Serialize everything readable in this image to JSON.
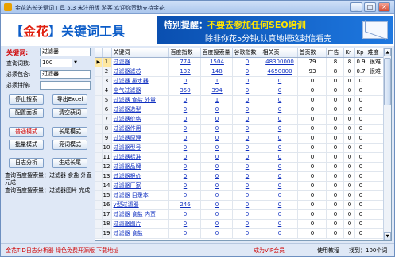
{
  "window": {
    "title": "金花站长关键词工具 5.3 未注册版 游客 欢迎你赞助支持金花",
    "controls": [
      "_",
      "□",
      "×"
    ]
  },
  "banner": {
    "brand_open": "【",
    "brand_hl": "金花",
    "brand_close": "】关键词工具",
    "promo_line1_a": "特别提醒：",
    "promo_line1_b": "不要去参加任何SEO培训",
    "promo_line2": "除非你花5分钟,认真地把这封信看完"
  },
  "form": {
    "keyword_label": "关键词:",
    "keyword_value": "过滤器",
    "limit_label": "查询词数:",
    "limit_value": "100",
    "must_include_label": "必须包含:",
    "must_include_value": "过滤器",
    "must_exclude_label": "必须排除:",
    "must_exclude_value": ""
  },
  "buttons": {
    "stop": "停止搜索",
    "export": "导出Excel",
    "config": "配置面板",
    "clear": "清空获词",
    "mode_normal": "普通模式",
    "mode_long": "长尾模式",
    "mode_batch": "批量模式",
    "mode_competitor": "竞词模式",
    "log": "日志分析",
    "gen_long": "生成长尾"
  },
  "status_lines": [
    "查询百度搜索量：过滤器 食盐 外直 元成",
    "查询百度搜索量：过滤器图片 完成"
  ],
  "table": {
    "columns": [
      "",
      "关键词",
      "百度指数",
      "百度搜索量",
      "谷歌指数",
      "相关页",
      "首页数",
      "广告",
      "Kr",
      "Kp",
      "难度"
    ],
    "rows": [
      [
        "1",
        "过滤器",
        "774",
        "1504",
        "0",
        "48300000",
        "79",
        "8",
        "8",
        "0.9",
        "很难"
      ],
      [
        "2",
        "过滤器滤芯",
        "132",
        "148",
        "0",
        "4650000",
        "93",
        "8",
        "0",
        "0.7",
        "很难"
      ],
      [
        "3",
        "过滤器 排水器",
        "0",
        "1",
        "0",
        "0",
        "0",
        "0",
        "0",
        "0",
        ""
      ],
      [
        "4",
        "空气过滤器",
        "350",
        "394",
        "0",
        "0",
        "0",
        "0",
        "0",
        "0",
        ""
      ],
      [
        "5",
        "过滤器 食盐 外量",
        "0",
        "1",
        "0",
        "0",
        "0",
        "0",
        "0",
        "0",
        ""
      ],
      [
        "6",
        "过滤器选型",
        "0",
        "0",
        "0",
        "0",
        "0",
        "0",
        "0",
        "0",
        ""
      ],
      [
        "7",
        "过滤器价格",
        "0",
        "0",
        "0",
        "0",
        "0",
        "0",
        "0",
        "0",
        ""
      ],
      [
        "8",
        "过滤器作用",
        "0",
        "0",
        "0",
        "0",
        "0",
        "0",
        "0",
        "0",
        ""
      ],
      [
        "9",
        "过滤器原理",
        "0",
        "0",
        "0",
        "0",
        "0",
        "0",
        "0",
        "0",
        ""
      ],
      [
        "10",
        "过滤器型号",
        "0",
        "0",
        "0",
        "0",
        "0",
        "0",
        "0",
        "0",
        ""
      ],
      [
        "11",
        "过滤器标准",
        "0",
        "0",
        "0",
        "0",
        "0",
        "0",
        "0",
        "0",
        ""
      ],
      [
        "12",
        "过滤器品牌",
        "0",
        "0",
        "0",
        "0",
        "0",
        "0",
        "0",
        "0",
        ""
      ],
      [
        "13",
        "过滤器报价",
        "0",
        "0",
        "0",
        "0",
        "0",
        "0",
        "0",
        "0",
        ""
      ],
      [
        "14",
        "过滤器厂家",
        "0",
        "0",
        "0",
        "0",
        "0",
        "0",
        "0",
        "0",
        ""
      ],
      [
        "15",
        "过滤器 目录本",
        "0",
        "0",
        "0",
        "0",
        "0",
        "0",
        "0",
        "0",
        ""
      ],
      [
        "16",
        "y型过滤器",
        "246",
        "0",
        "0",
        "0",
        "0",
        "0",
        "0",
        "0",
        ""
      ],
      [
        "17",
        "过滤器 食盐 内贾",
        "0",
        "0",
        "0",
        "0",
        "0",
        "0",
        "0",
        "0",
        ""
      ],
      [
        "18",
        "过滤器图片",
        "0",
        "0",
        "0",
        "0",
        "0",
        "0",
        "0",
        "0",
        ""
      ],
      [
        "19",
        "过滤器 食盐",
        "0",
        "0",
        "0",
        "0",
        "0",
        "0",
        "0",
        "0",
        ""
      ]
    ]
  },
  "statusbar": {
    "ad": "金花TID日志分析器 绿色免费开源版 下载地址",
    "vip": "成为VIP会员",
    "tutorial": "使用教程",
    "found": "找到：100个词"
  }
}
